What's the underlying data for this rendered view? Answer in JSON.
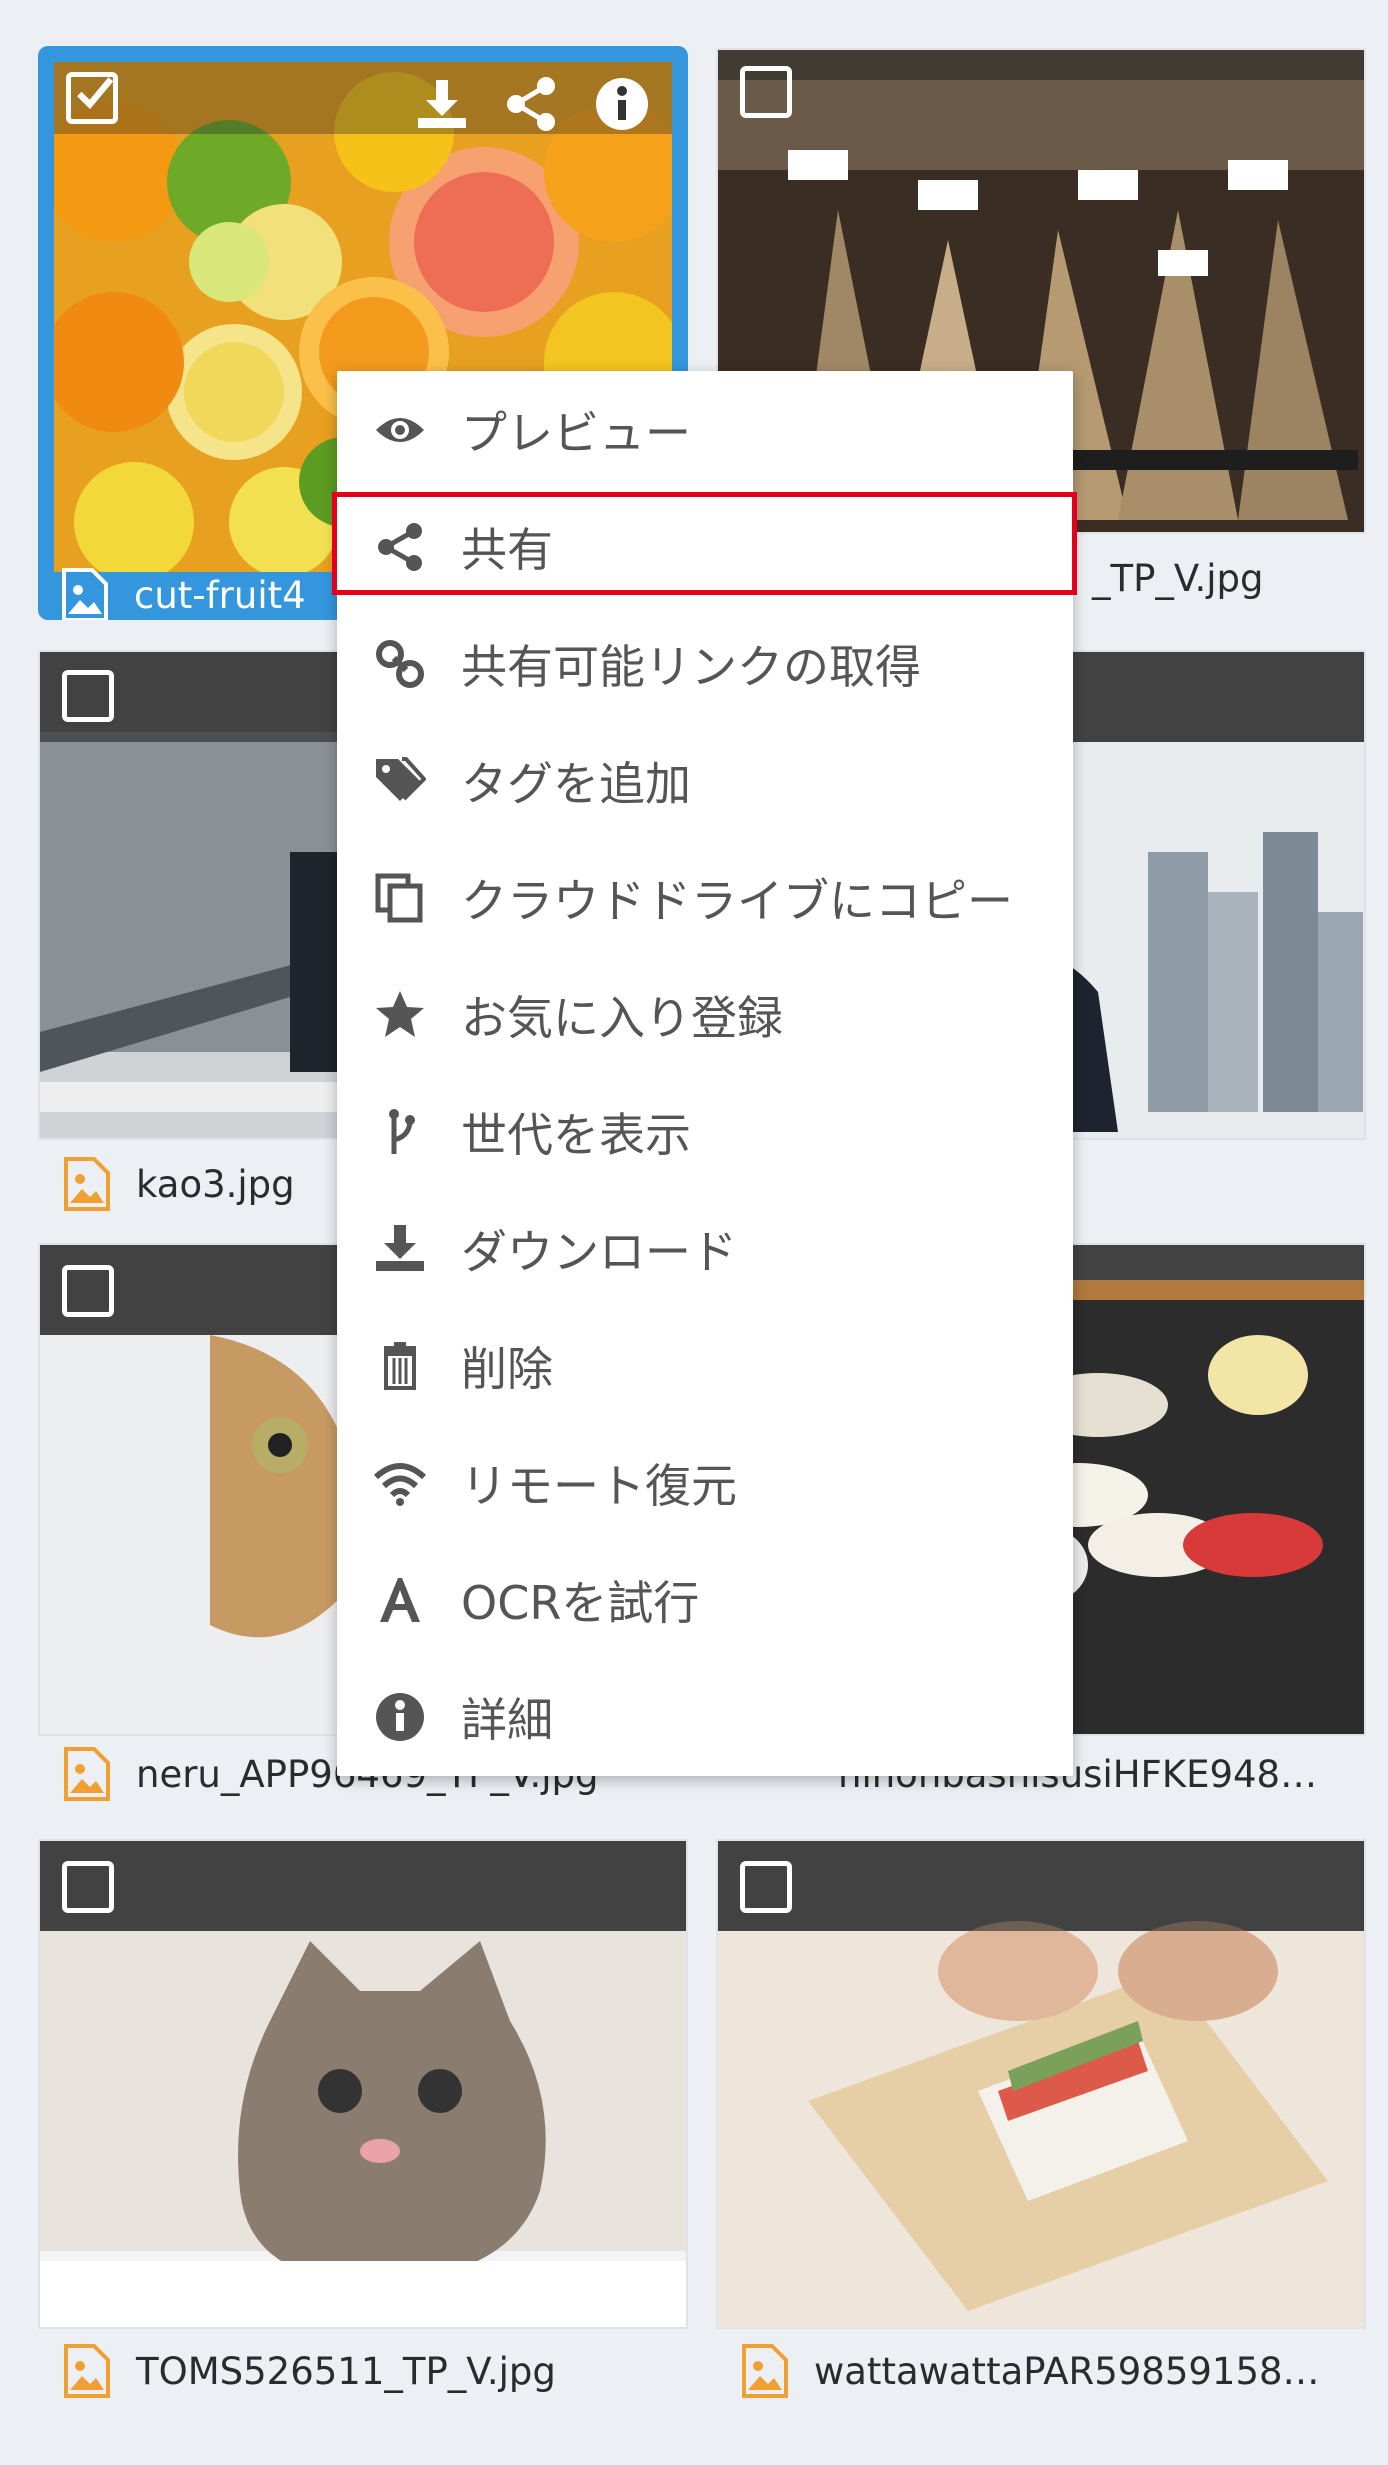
{
  "files": [
    {
      "name": "cut-fruit4",
      "selected": true
    },
    {
      "name": "_TP_V.jpg"
    },
    {
      "name": "kao3.jpg"
    },
    {
      "name": ""
    },
    {
      "name": "neru_APP96469_TP_V.jpg"
    },
    {
      "name": "nihonbashisusiHFKE948…"
    },
    {
      "name": "TOMS526511_TP_V.jpg"
    },
    {
      "name": "wattawattaPAR59859158…"
    }
  ],
  "selected_toolbar": {
    "icons": [
      "download-icon",
      "share-icon",
      "info-icon"
    ]
  },
  "context_menu": {
    "items": [
      {
        "label": "プレビュー",
        "icon": "eye-icon"
      },
      {
        "label": "共有",
        "icon": "share-icon"
      },
      {
        "label": "共有可能リンクの取得",
        "icon": "link-icon"
      },
      {
        "label": "タグを追加",
        "icon": "tags-icon"
      },
      {
        "label": "クラウドドライブにコピー",
        "icon": "copy-icon"
      },
      {
        "label": "お気に入り登録",
        "icon": "star-icon"
      },
      {
        "label": "世代を表示",
        "icon": "branch-icon"
      },
      {
        "label": "ダウンロード",
        "icon": "download-icon"
      },
      {
        "label": "削除",
        "icon": "trash-icon"
      },
      {
        "label": "リモート復元",
        "icon": "wifi-icon"
      },
      {
        "label": "OCRを試行",
        "icon": "font-a-icon"
      },
      {
        "label": "詳細",
        "icon": "info-icon"
      }
    ],
    "highlighted_item": "共有"
  },
  "colors": {
    "accent": "#3496dd",
    "highlight_border": "#e4001a",
    "file_icon": "#f0a030"
  }
}
